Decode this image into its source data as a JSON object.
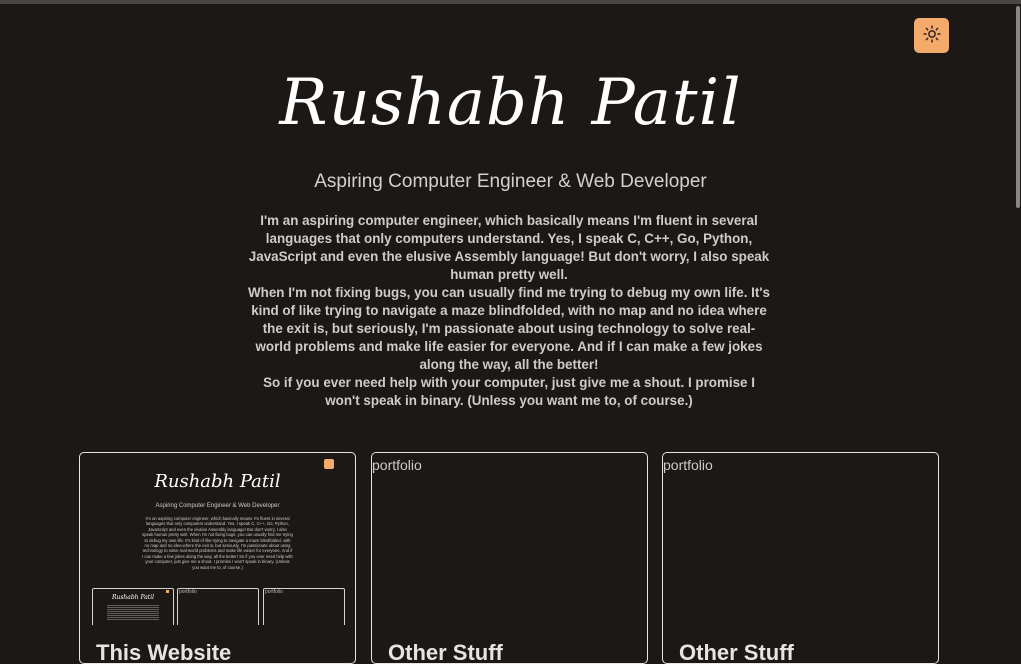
{
  "header": {
    "name": "Rushabh Patil",
    "subtitle": "Aspiring Computer Engineer & Web Developer",
    "theme_toggle_icon": "sun-icon"
  },
  "bio": {
    "p1": "I'm an aspiring computer engineer, which basically means I'm fluent in several languages that only computers understand. Yes, I speak C, C++, Go, Python, JavaScript and even the elusive Assembly language! But don't worry, I also speak human pretty well.",
    "p2": "When I'm not fixing bugs, you can usually find me trying to debug my own life. It's kind of like trying to navigate a maze blindfolded, with no map and no idea where the exit is, but seriously, I'm passionate about using technology to solve real-world problems and make life easier for everyone. And if I can make a few jokes along the way, all the better!",
    "p3": "So if you ever need help with your computer, just give me a shout. I promise I won't speak in binary. (Unless you want me to, of course.)"
  },
  "projects": [
    {
      "alt": "",
      "title": "This Website"
    },
    {
      "alt": "portfolio",
      "title": "Other Stuff"
    },
    {
      "alt": "portfolio",
      "title": "Other Stuff"
    }
  ],
  "thumbnail": {
    "name": "Rushabh Patil",
    "subtitle": "Aspiring Computer Engineer & Web Developer",
    "bio": "I'm an aspiring computer engineer, which basically means I'm fluent in several languages that only computers understand. Yes, I speak C, C++, Go, Python, JavaScript and even the elusive Assembly language! But don't worry, I also speak human pretty well. When I'm not fixing bugs, you can usually find me trying to debug my own life. It's kind of like trying to navigate a maze blindfolded, with no map and no idea where the exit is, but seriously, I'm passionate about using technology to solve real-world problems and make life easier for everyone. And if I can make a few jokes along the way, all the better! So if you ever need help with your computer, just give me a shout. I promise I won't speak in binary. (Unless you want me to, of course.)",
    "mini_cards": [
      {
        "label": "",
        "name": "Rushabh Patil"
      },
      {
        "label": "portfolio",
        "name": ""
      },
      {
        "label": "portfolio",
        "name": ""
      }
    ]
  },
  "colors": {
    "background": "#1c1816",
    "accent": "#f4aa6a",
    "text": "#cfcac6"
  }
}
